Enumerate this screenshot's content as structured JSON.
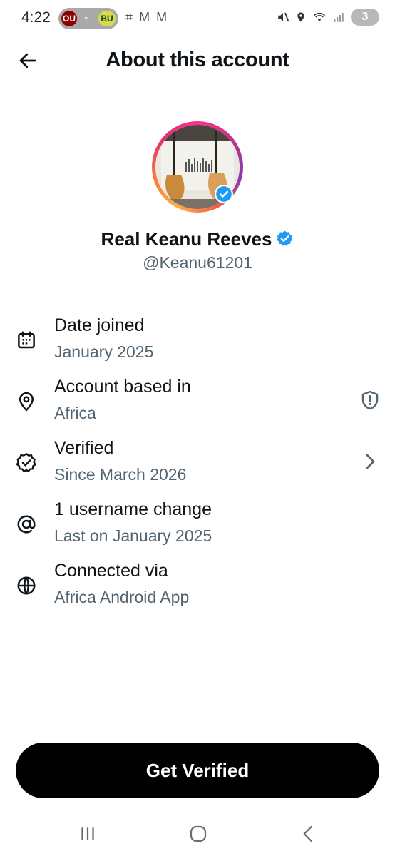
{
  "status_bar": {
    "time": "4:22",
    "team_left": "OU",
    "separator": "-",
    "team_right": "BU",
    "notification_icons": "⌗ M M",
    "battery_level": "3"
  },
  "header": {
    "title": "About this account"
  },
  "profile": {
    "display_name": "Real Keanu Reeves",
    "handle": "@Keanu61201",
    "verified": true
  },
  "info_rows": [
    {
      "icon": "calendar-icon",
      "title": "Date joined",
      "subtitle": "January 2025"
    },
    {
      "icon": "location-pin-icon",
      "title": "Account based in",
      "subtitle": "Africa",
      "trailing_icon": "shield-alert-icon"
    },
    {
      "icon": "verified-badge-icon",
      "title": "Verified",
      "subtitle": "Since March 2026",
      "trailing_icon": "chevron-right-icon"
    },
    {
      "icon": "at-sign-icon",
      "title": "1 username change",
      "subtitle": "Last on January 2025"
    },
    {
      "icon": "globe-icon",
      "title": "Connected via",
      "subtitle": "Africa Android App"
    }
  ],
  "cta": {
    "label": "Get Verified"
  },
  "colors": {
    "verified_blue": "#1d9bf0",
    "secondary_text": "#536471",
    "primary_text": "#0f1419"
  },
  "nav_bar": {
    "buttons": [
      "recent-apps-icon",
      "home-icon",
      "back-nav-icon"
    ]
  }
}
